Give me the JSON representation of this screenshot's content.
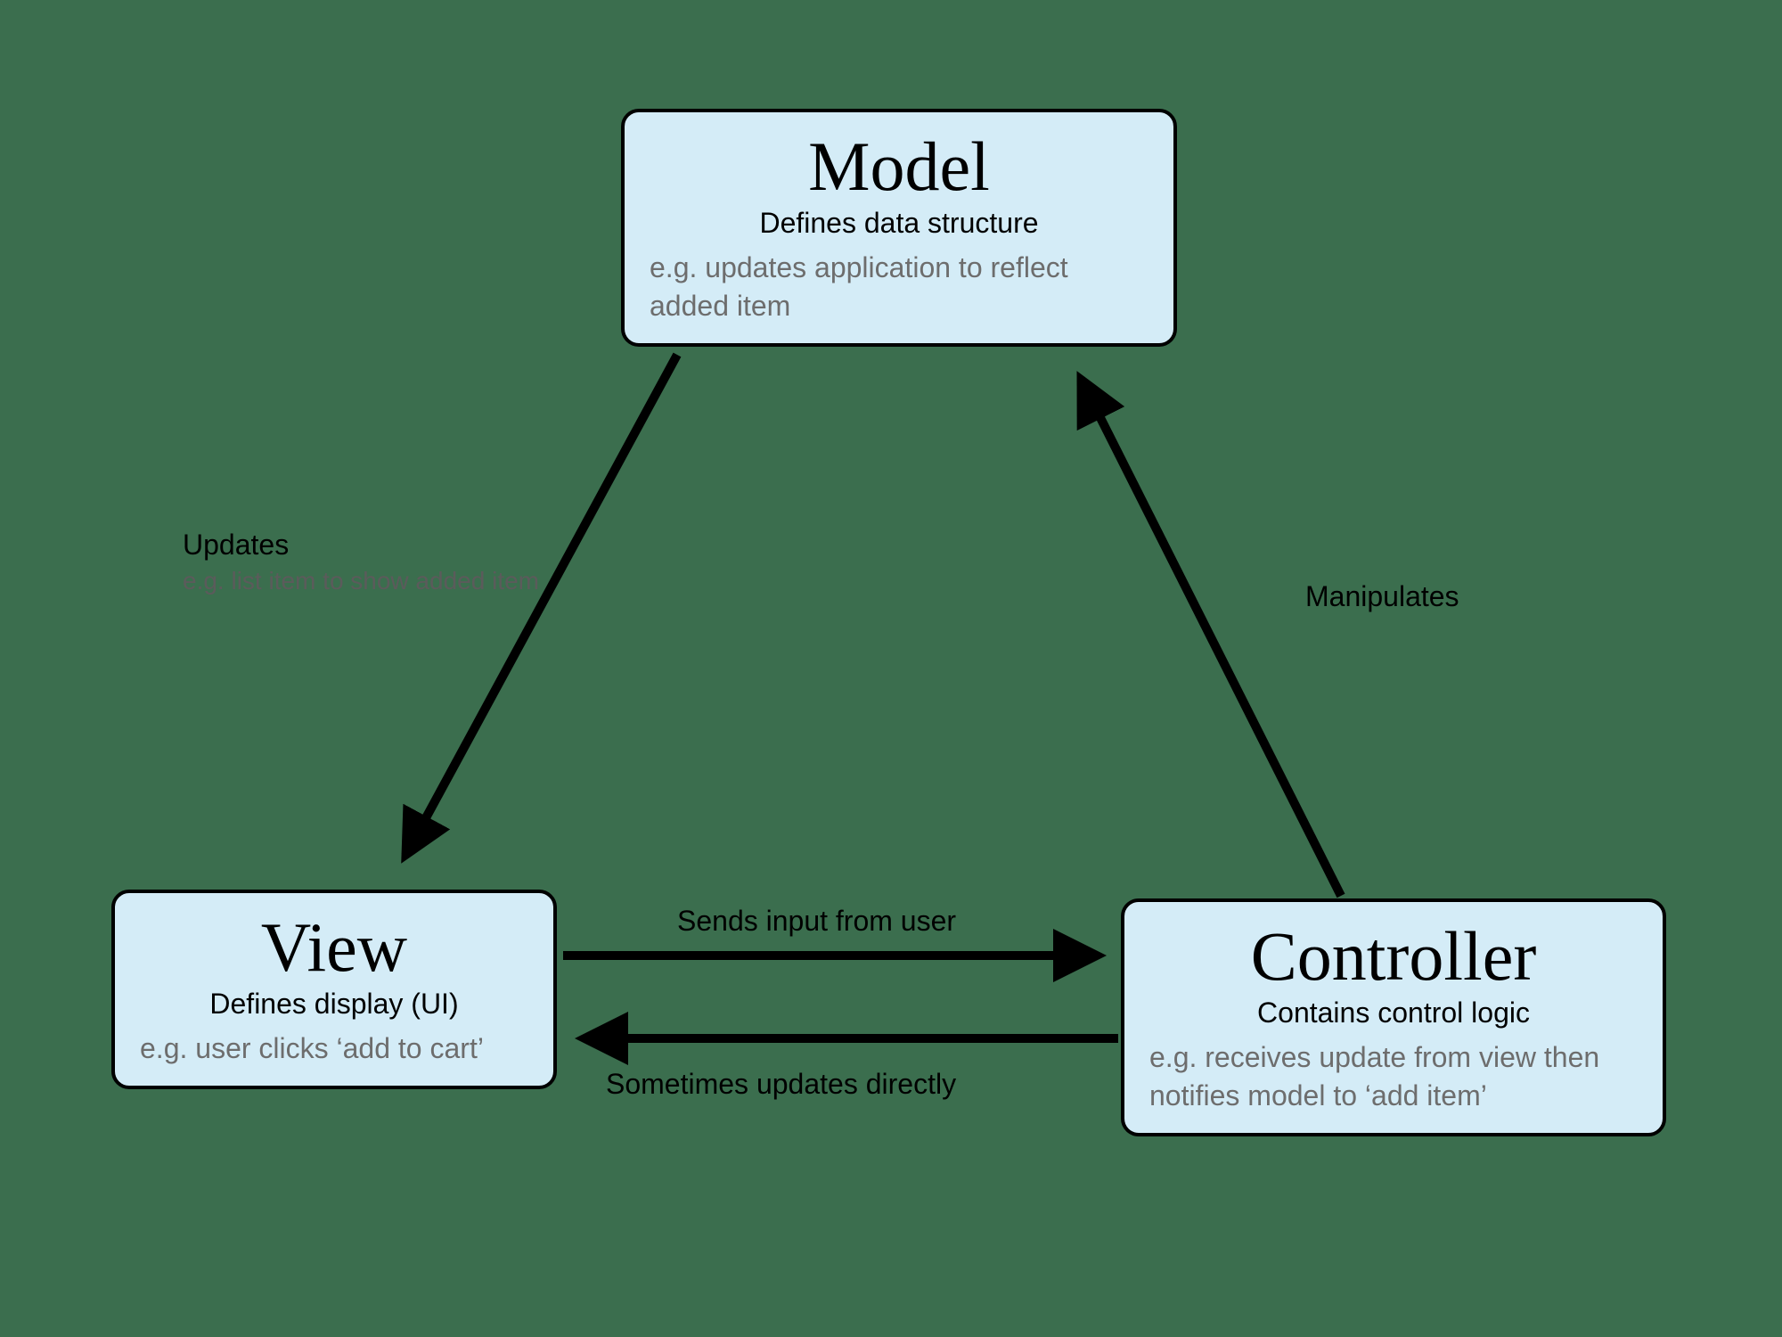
{
  "nodes": {
    "model": {
      "title": "Model",
      "subtitle": "Defines data structure",
      "example": "e.g. updates application to reflect added item"
    },
    "view": {
      "title": "View",
      "subtitle": "Defines display (UI)",
      "example": "e.g. user clicks ‘add to cart’"
    },
    "controller": {
      "title": "Controller",
      "subtitle": "Contains control logic",
      "example": "e.g. receives update from view then notifies model to ‘add item’"
    }
  },
  "edges": {
    "model_to_view": {
      "label": "Updates",
      "sub": "e.g. list item to show added item"
    },
    "controller_to_model": {
      "label": "Manipulates"
    },
    "view_to_controller": {
      "label": "Sends input from user"
    },
    "controller_to_view": {
      "label": "Sometimes updates directly"
    }
  }
}
